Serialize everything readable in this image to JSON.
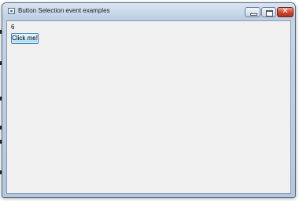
{
  "window": {
    "title": "Button Selection event examples",
    "icon": "window-app-icon",
    "controls": {
      "minimize_icon": "minimize-icon",
      "maximize_icon": "maximize-icon",
      "close_icon": "close-icon",
      "close_glyph": "✕"
    }
  },
  "content": {
    "counter_text": "6",
    "button_label": "Click me!"
  },
  "colors": {
    "close_button": "#c9452e",
    "client_background": "#f0f0f0",
    "button_border": "#3c7fb1"
  }
}
